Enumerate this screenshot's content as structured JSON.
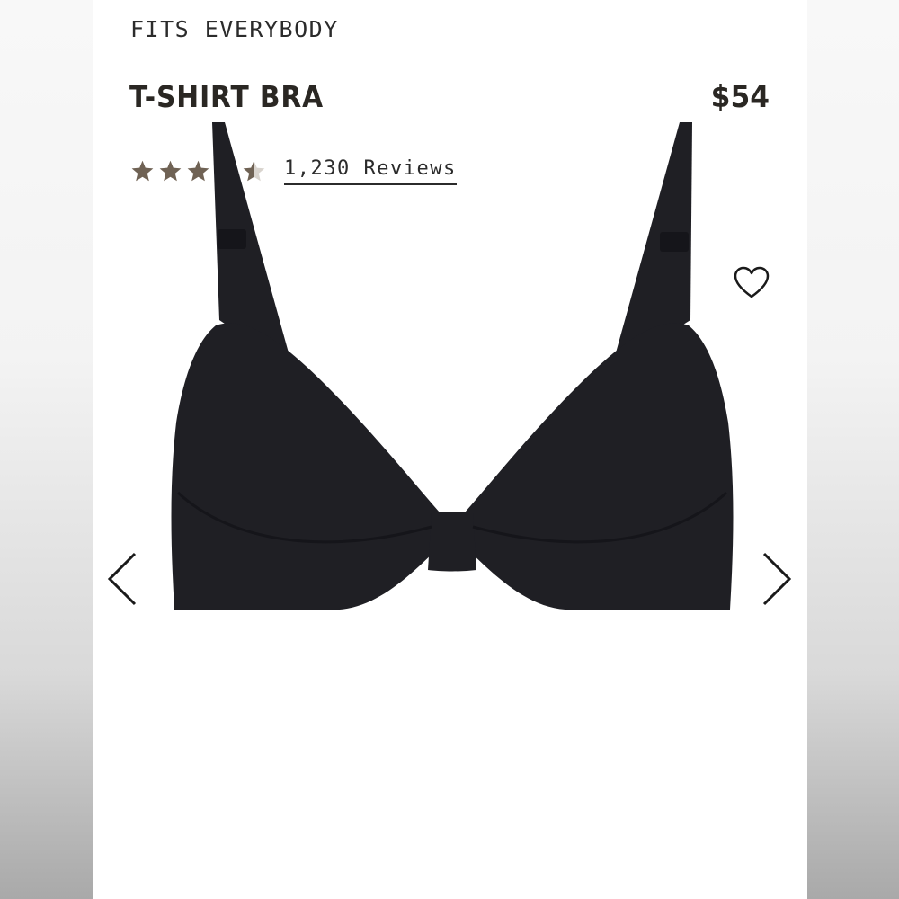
{
  "product": {
    "collection": "FITS EVERYBODY",
    "title": "T-SHIRT BRA",
    "price": "$54",
    "rating": 4.5,
    "max_rating": 5,
    "reviews_label": "1,230 Reviews"
  },
  "icons": {
    "wishlist": "heart-outline-icon",
    "prev": "chevron-left-icon",
    "next": "chevron-right-icon",
    "star": "star-icon"
  },
  "colors": {
    "text": "#2a2723",
    "star": "#6f6254",
    "product": "#1f1f24"
  }
}
